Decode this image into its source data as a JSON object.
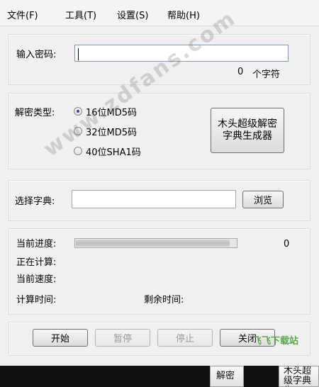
{
  "menu": {
    "file": "文件(F)",
    "tools": "工具(T)",
    "settings": "设置(S)",
    "help": "帮助(H)"
  },
  "password": {
    "label": "输入密码:",
    "value": "",
    "count": "0",
    "count_unit": "个字符"
  },
  "decrypt": {
    "label": "解密类型:",
    "options": [
      "16位MD5码",
      "32位MD5码",
      "40位SHA1码"
    ],
    "selected_index": 0,
    "generator_button": "木头超级解密字典生成器"
  },
  "dictionary": {
    "label": "选择字典:",
    "value": "",
    "browse_button": "浏览"
  },
  "progress": {
    "current_label": "当前进度:",
    "current_value": "0",
    "fill_fraction": 0.95,
    "computing_label": "正在计算:",
    "speed_label": "当前速度:",
    "elapsed_label": "计算时间:",
    "remaining_label": "剩余时间:"
  },
  "buttons": {
    "start": "开始",
    "pause": "暂停",
    "stop": "停止",
    "close": "关闭"
  },
  "watermark": "www.zdfans.com",
  "logo": "飞飞下载站",
  "taskbar": {
    "tile1": "解密",
    "tile2": "木头超级字典生"
  }
}
